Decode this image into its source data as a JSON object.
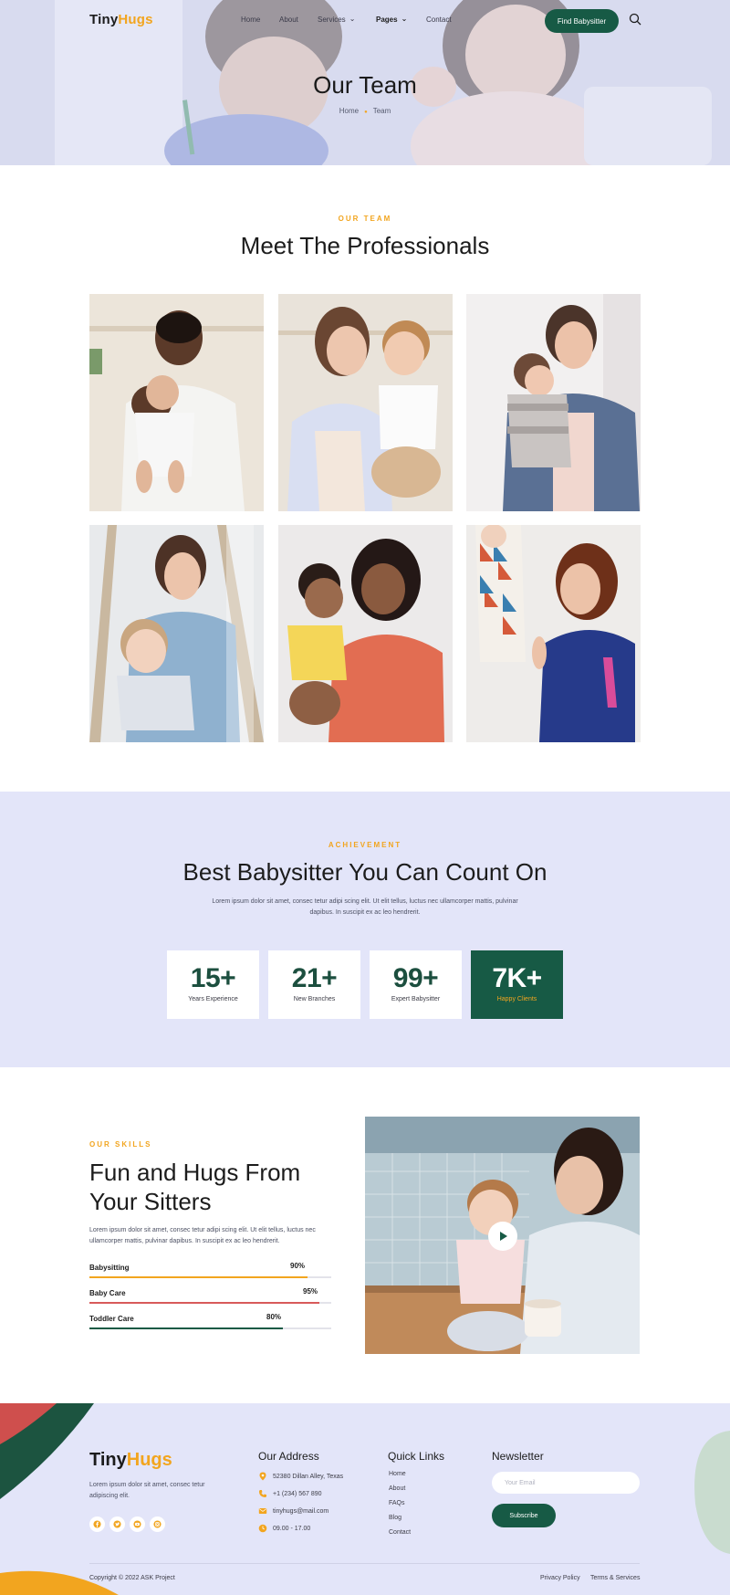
{
  "brand": {
    "tiny": "Tiny",
    "hugs": "Hugs",
    "accent": "#f2a51f",
    "green": "#175a45",
    "lavender": "#e3e5f9"
  },
  "nav": {
    "items": [
      "Home",
      "About",
      "Services",
      "Pages",
      "Contact"
    ],
    "cta": "Find Babysitter",
    "search_icon": "search-icon"
  },
  "hero": {
    "title": "Our Team",
    "breadcrumb": [
      "Home",
      "Team"
    ]
  },
  "team": {
    "eyebrow": "OUR TEAM",
    "title": "Meet The Professionals"
  },
  "achievement": {
    "eyebrow": "ACHIEVEMENT",
    "title": "Best Babysitter You Can Count On",
    "description": "Lorem ipsum dolor sit amet, consec tetur adipi scing elit. Ut elit tellus, luctus nec ullamcorper mattis, pulvinar dapibus. In suscipit ex ac leo hendrerit.",
    "stats": [
      {
        "value": "15+",
        "label": "Years Experience"
      },
      {
        "value": "21+",
        "label": "New Branches"
      },
      {
        "value": "99+",
        "label": "Expert Babysitter"
      },
      {
        "value": "7K+",
        "label": "Happy Clients"
      }
    ]
  },
  "skills": {
    "eyebrow": "OUR SKILLS",
    "title": "Fun and Hugs From Your Sitters",
    "description": "Lorem ipsum dolor sit amet, consec tetur adipi scing elit. Ut elit tellus, luctus nec ullamcorper mattis, pulvinar dapibus. In suscipit ex ac leo hendrerit.",
    "items": [
      {
        "name": "Babysitting",
        "value": "90%",
        "fraction": 0.9,
        "color": "#f2a51f"
      },
      {
        "name": "Baby Care",
        "value": "95%",
        "fraction": 0.95,
        "color": "#d85a5a"
      },
      {
        "name": "Toddler Care",
        "value": "80%",
        "fraction": 0.8,
        "color": "#175a45"
      }
    ],
    "video_icon": "play-icon"
  },
  "footer": {
    "about": "Lorem ipsum dolor sit amet, consec tetur adipiscing elit.",
    "social_icons": [
      "facebook-icon",
      "twitter-icon",
      "youtube-icon",
      "instagram-icon"
    ],
    "address_heading": "Our Address",
    "address": [
      {
        "icon": "location-pin-icon",
        "text": "52380 Dillan Alley, Texas"
      },
      {
        "icon": "phone-icon",
        "text": "+1 (234) 567 890"
      },
      {
        "icon": "mail-icon",
        "text": "tinyhugs@mail.com"
      },
      {
        "icon": "clock-icon",
        "text": "09.00 - 17.00"
      }
    ],
    "links_heading": "Quick Links",
    "links": [
      "Home",
      "About",
      "FAQs",
      "Blog",
      "Contact"
    ],
    "newsletter_heading": "Newsletter",
    "email_placeholder": "Your Email",
    "subscribe": "Subscribe",
    "copyright": "Copyright © 2022 ASK Project",
    "bottom_links": [
      "Privacy Policy",
      "Terms & Services"
    ]
  }
}
